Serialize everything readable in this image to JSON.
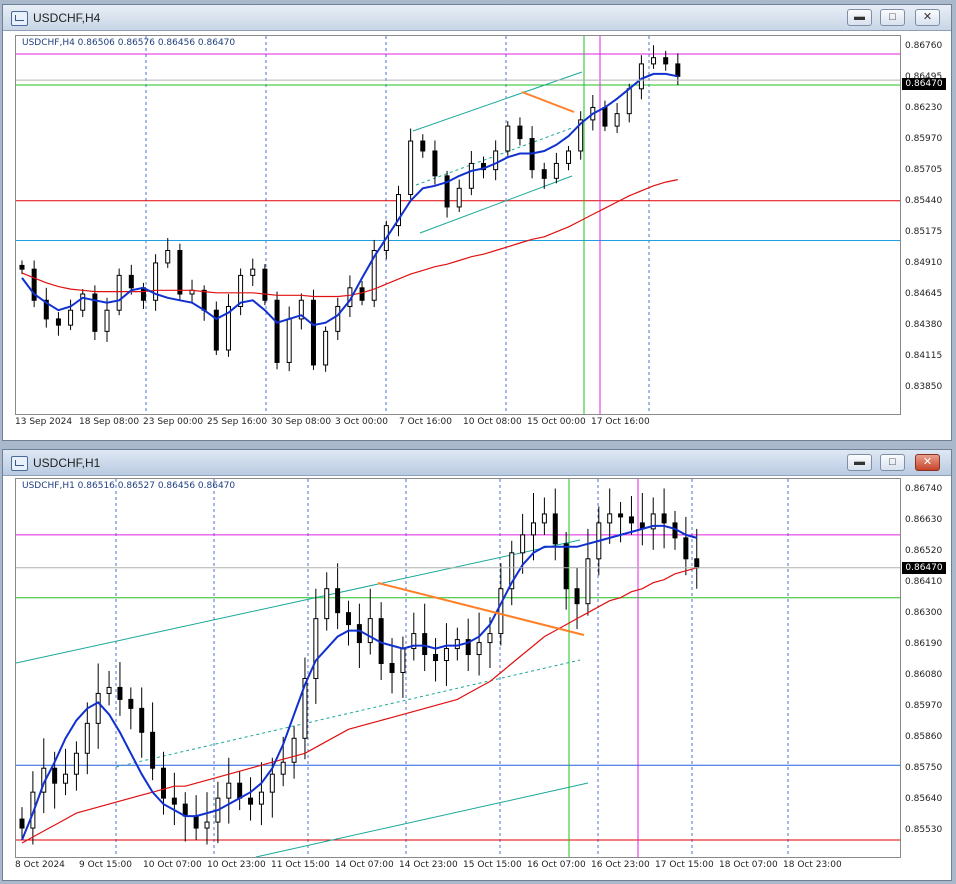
{
  "windows": [
    {
      "title": "USDCHF,H4",
      "header": "USDCHF,H4  0.86506 0.86576 0.86456 0.86470",
      "price_tag": "0.86470",
      "yaxis": [
        "0.86760",
        "0.86495",
        "0.86230",
        "0.85970",
        "0.85705",
        "0.85440",
        "0.85175",
        "0.84910",
        "0.84645",
        "0.84380",
        "0.84115",
        "0.83850"
      ],
      "xaxis": [
        "13 Sep 2024",
        "18 Sep 08:00",
        "23 Sep 00:00",
        "25 Sep 16:00",
        "30 Sep 08:00",
        "3 Oct 00:00",
        "7 Oct 16:00",
        "10 Oct 08:00",
        "15 Oct 00:00",
        "17 Oct 16:00"
      ],
      "buttons": {
        "minimize": "▬",
        "maximize": "□",
        "close": "✕"
      }
    },
    {
      "title": "USDCHF,H1",
      "header": "USDCHF,H1  0.86516 0.86527 0.86456 0.86470",
      "price_tag": "0.86470",
      "yaxis": [
        "0.86740",
        "0.86630",
        "0.86520",
        "0.86410",
        "0.86300",
        "0.86190",
        "0.86080",
        "0.85970",
        "0.85860",
        "0.85750",
        "0.85640",
        "0.85530"
      ],
      "xaxis": [
        "8 Oct 2024",
        "9 Oct 15:00",
        "10 Oct 07:00",
        "10 Oct 23:00",
        "11 Oct 15:00",
        "14 Oct 07:00",
        "14 Oct 23:00",
        "15 Oct 15:00",
        "16 Oct 07:00",
        "16 Oct 23:00",
        "17 Oct 15:00",
        "18 Oct 07:00",
        "18 Oct 23:00"
      ],
      "buttons": {
        "minimize": "▬",
        "maximize": "□",
        "close": "✕"
      }
    }
  ],
  "colors": {
    "candle": "#000000",
    "ma_fast": "#1030d0",
    "ma_slow": "#e01010",
    "level_magenta": "#e020e0",
    "level_green": "#20c020",
    "level_red": "#e00000",
    "level_blue": "#2060e0",
    "level_cyan": "#20a0e0",
    "channel": "#18a898",
    "trendline": "#ff7f27",
    "grid": "#2050c0"
  },
  "chart_data": [
    {
      "type": "candlestick",
      "title": "USDCHF,H4",
      "ylim": [
        0.8385,
        0.8676
      ],
      "close": 0.8647,
      "ohlc_last": {
        "open": 0.86506,
        "high": 0.86576,
        "low": 0.86456,
        "close": 0.8647
      },
      "x_ticks": [
        "13 Sep 2024",
        "18 Sep 08:00",
        "23 Sep 00:00",
        "25 Sep 16:00",
        "30 Sep 08:00",
        "3 Oct 00:00",
        "7 Oct 16:00",
        "10 Oct 08:00",
        "15 Oct 00:00",
        "17 Oct 16:00"
      ],
      "closes": [
        0.8495,
        0.847,
        0.8455,
        0.845,
        0.8462,
        0.8475,
        0.8445,
        0.8462,
        0.849,
        0.848,
        0.847,
        0.85,
        0.851,
        0.8475,
        0.8478,
        0.8462,
        0.843,
        0.8465,
        0.849,
        0.8495,
        0.847,
        0.842,
        0.8455,
        0.847,
        0.8418,
        0.8445,
        0.8465,
        0.848,
        0.847,
        0.851,
        0.853,
        0.8555,
        0.8598,
        0.859,
        0.857,
        0.8545,
        0.856,
        0.858,
        0.8575,
        0.859,
        0.861,
        0.86,
        0.8575,
        0.8568,
        0.858,
        0.859,
        0.8615,
        0.8625,
        0.861,
        0.862,
        0.864,
        0.866,
        0.8665,
        0.866,
        0.865
      ],
      "ma_fast": [
        0.8488,
        0.8475,
        0.8468,
        0.8462,
        0.8465,
        0.8472,
        0.847,
        0.8468,
        0.847,
        0.8478,
        0.848,
        0.8475,
        0.8472,
        0.847,
        0.8468,
        0.8462,
        0.8455,
        0.846,
        0.8468,
        0.847,
        0.8462,
        0.8452,
        0.8455,
        0.8458,
        0.845,
        0.8452,
        0.8458,
        0.847,
        0.8488,
        0.8505,
        0.852,
        0.8535,
        0.855,
        0.856,
        0.8562,
        0.8565,
        0.857,
        0.8574,
        0.8576,
        0.858,
        0.8585,
        0.8588,
        0.8588,
        0.859,
        0.8595,
        0.8602,
        0.8612,
        0.862,
        0.8625,
        0.8632,
        0.864,
        0.8648,
        0.8652,
        0.8652,
        0.865
      ],
      "ma_slow": [
        0.8492,
        0.8488,
        0.8484,
        0.8481,
        0.8479,
        0.8478,
        0.8477,
        0.8477,
        0.8477,
        0.8477,
        0.8477,
        0.8478,
        0.8478,
        0.8478,
        0.8478,
        0.8477,
        0.8476,
        0.8476,
        0.8476,
        0.8476,
        0.8475,
        0.8474,
        0.8474,
        0.8474,
        0.8473,
        0.8473,
        0.8473,
        0.8474,
        0.8476,
        0.8479,
        0.8483,
        0.8487,
        0.8491,
        0.8494,
        0.8497,
        0.8499,
        0.8502,
        0.8505,
        0.8507,
        0.851,
        0.8513,
        0.8516,
        0.8519,
        0.8521,
        0.8525,
        0.8529,
        0.8534,
        0.8539,
        0.8544,
        0.8549,
        0.8554,
        0.8558,
        0.8562,
        0.8565,
        0.8567
      ]
    },
    {
      "type": "candlestick",
      "title": "USDCHF,H1",
      "ylim": [
        0.8553,
        0.8674
      ],
      "close": 0.8647,
      "ohlc_last": {
        "open": 0.86516,
        "high": 0.86527,
        "low": 0.86456,
        "close": 0.8647
      },
      "x_ticks": [
        "8 Oct 2024",
        "9 Oct 15:00",
        "10 Oct 07:00",
        "10 Oct 23:00",
        "11 Oct 15:00",
        "14 Oct 07:00",
        "14 Oct 23:00",
        "15 Oct 15:00",
        "16 Oct 07:00",
        "16 Oct 23:00",
        "17 Oct 15:00",
        "18 Oct 07:00",
        "18 Oct 23:00"
      ],
      "closes": [
        0.856,
        0.8572,
        0.858,
        0.8575,
        0.8578,
        0.8585,
        0.8595,
        0.8605,
        0.8607,
        0.8603,
        0.86,
        0.8592,
        0.858,
        0.857,
        0.8568,
        0.8564,
        0.856,
        0.8562,
        0.857,
        0.8575,
        0.857,
        0.8568,
        0.8572,
        0.8578,
        0.8582,
        0.859,
        0.861,
        0.863,
        0.864,
        0.8632,
        0.8628,
        0.8622,
        0.863,
        0.8615,
        0.8612,
        0.862,
        0.8625,
        0.8618,
        0.8616,
        0.862,
        0.8623,
        0.8618,
        0.8622,
        0.8625,
        0.864,
        0.8652,
        0.8658,
        0.8662,
        0.8665,
        0.8655,
        0.864,
        0.8635,
        0.865,
        0.8662,
        0.8665,
        0.8664,
        0.8662,
        0.866,
        0.8665,
        0.8662,
        0.8657,
        0.865,
        0.8647
      ],
      "ma_fast": [
        0.8556,
        0.8565,
        0.8575,
        0.8582,
        0.859,
        0.8596,
        0.86,
        0.8602,
        0.8598,
        0.8592,
        0.8585,
        0.8578,
        0.8572,
        0.8568,
        0.8566,
        0.8564,
        0.8564,
        0.8565,
        0.8566,
        0.8568,
        0.857,
        0.8572,
        0.8575,
        0.858,
        0.8588,
        0.8598,
        0.8608,
        0.8616,
        0.862,
        0.8624,
        0.8626,
        0.8626,
        0.8624,
        0.8622,
        0.8621,
        0.862,
        0.8621,
        0.8621,
        0.862,
        0.8621,
        0.8621,
        0.8622,
        0.8624,
        0.8628,
        0.8635,
        0.8642,
        0.8648,
        0.8652,
        0.8654,
        0.8654,
        0.8654,
        0.8654,
        0.8655,
        0.8656,
        0.8657,
        0.8658,
        0.8659,
        0.866,
        0.8661,
        0.8661,
        0.866,
        0.8658,
        0.8657
      ],
      "ma_slow": [
        0.8555,
        0.8557,
        0.8559,
        0.8561,
        0.8563,
        0.8565,
        0.8566,
        0.8567,
        0.8568,
        0.8569,
        0.857,
        0.8571,
        0.8572,
        0.8573,
        0.8574,
        0.8574,
        0.8575,
        0.8576,
        0.8577,
        0.8578,
        0.8579,
        0.858,
        0.8581,
        0.8582,
        0.8583,
        0.8584,
        0.8585,
        0.8587,
        0.8589,
        0.8591,
        0.8593,
        0.8594,
        0.8595,
        0.8596,
        0.8597,
        0.8598,
        0.8599,
        0.86,
        0.8601,
        0.8602,
        0.8603,
        0.8605,
        0.8607,
        0.8609,
        0.8612,
        0.8615,
        0.8618,
        0.8621,
        0.8624,
        0.8626,
        0.8628,
        0.863,
        0.8632,
        0.8634,
        0.8636,
        0.8637,
        0.8639,
        0.864,
        0.8642,
        0.8643,
        0.8645,
        0.8646,
        0.8647
      ]
    }
  ]
}
